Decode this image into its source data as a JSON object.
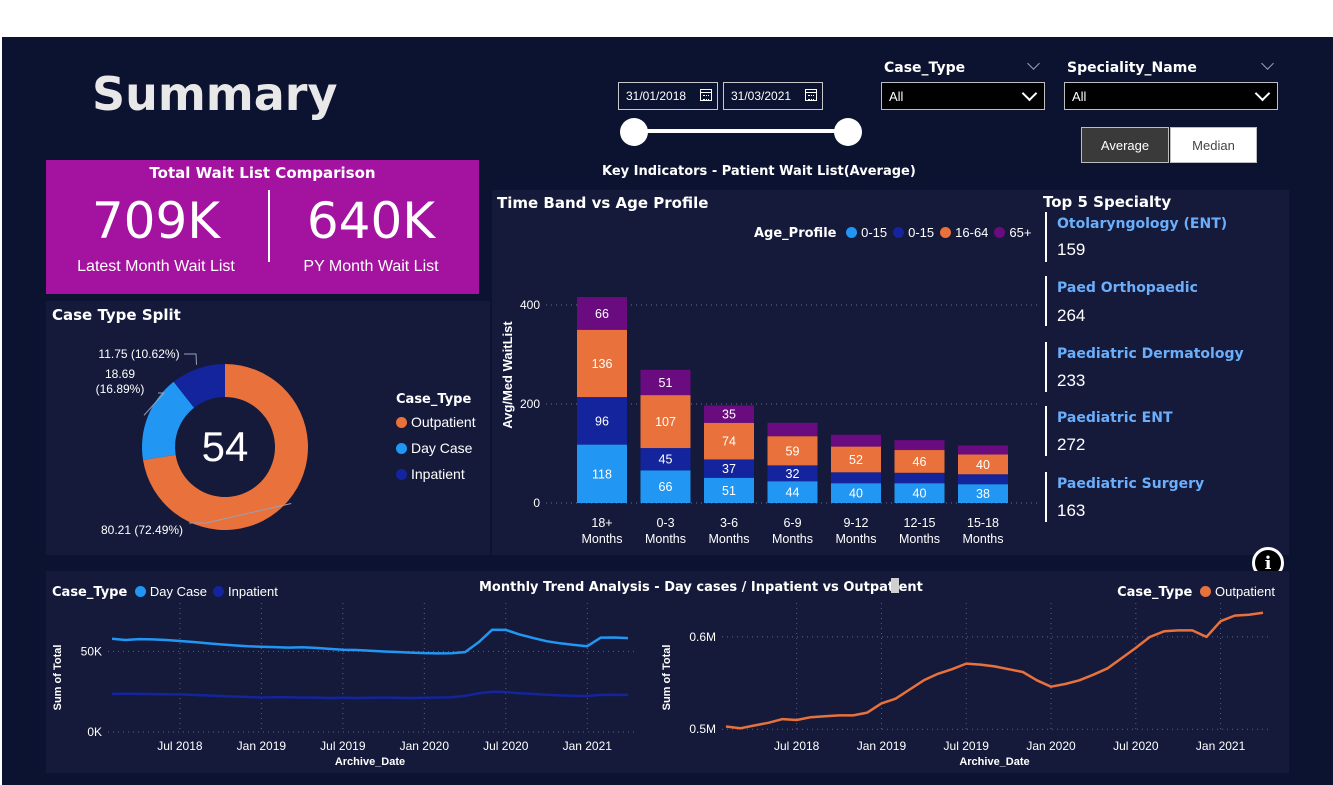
{
  "page": {
    "title": "Summary"
  },
  "filters": {
    "start_date": "31/01/2018",
    "end_date": "31/03/2021",
    "case_type": {
      "label": "Case_Type",
      "value": "All"
    },
    "speciality": {
      "label": "Speciality_Name",
      "value": "All"
    },
    "stat_toggle": {
      "average": "Average",
      "median": "Median",
      "selected": "Average"
    }
  },
  "key_indicators_title": "Key Indicators - Patient Wait List(Average)",
  "kpi": {
    "title": "Total Wait List Comparison",
    "latest_value": "709K",
    "latest_label": "Latest Month Wait List",
    "py_value": "640K",
    "py_label": "PY Month Wait List",
    "color": "#a3139f"
  },
  "top5": {
    "title": "Top 5 Specialty",
    "items": [
      {
        "name": "Otolaryngology (ENT)",
        "value": "159"
      },
      {
        "name": "Paed Orthopaedic",
        "value": "264"
      },
      {
        "name": "Paediatric Dermatology",
        "value": "233"
      },
      {
        "name": "Paediatric ENT",
        "value": "272"
      },
      {
        "name": "Paediatric Surgery",
        "value": "163"
      }
    ]
  },
  "chart_data": [
    {
      "id": "case-type-split",
      "type": "pie",
      "title": "Case Type Split",
      "center_value": "54",
      "legend_title": "Case_Type",
      "legend_position": "right",
      "slices": [
        {
          "name": "Outpatient",
          "value": 80.21,
          "label": "80.21 (72.49%)",
          "color": "#e8713c"
        },
        {
          "name": "Day Case",
          "value": 18.69,
          "label": "18.69 (16.89%)",
          "label_lines": [
            "18.69",
            "(16.89%)"
          ],
          "color": "#2196f3"
        },
        {
          "name": "Inpatient",
          "value": 11.75,
          "label": "11.75 (10.62%)",
          "color": "#13249c"
        }
      ]
    },
    {
      "id": "time-band-age",
      "type": "bar",
      "stacked": true,
      "title": "Time Band vs Age Profile",
      "ylabel": "Avg/Med WaitList",
      "xlabel": "",
      "ylim": [
        0,
        400
      ],
      "yticks": [
        0,
        200,
        400
      ],
      "grid": true,
      "legend_title": "Age_Profile",
      "legend_position": "top-right",
      "categories": [
        [
          "18+",
          "Months"
        ],
        [
          "0-3",
          "Months"
        ],
        [
          "3-6",
          "Months"
        ],
        [
          "6-9",
          "Months"
        ],
        [
          "9-12",
          "Months"
        ],
        [
          "12-15",
          "Months"
        ],
        [
          "15-18",
          "Months"
        ]
      ],
      "series": [
        {
          "name": "0-15",
          "color": "#2196f3",
          "values": [
            118,
            66,
            51,
            44,
            40,
            40,
            38
          ],
          "labels": [
            "118",
            "66",
            "51",
            "44",
            "40",
            "40",
            "38"
          ]
        },
        {
          "name": "0-15",
          "color": "#13249c",
          "values": [
            96,
            45,
            37,
            32,
            22,
            21,
            20
          ],
          "labels": [
            "96",
            "45",
            "37",
            "32",
            "",
            "",
            ""
          ]
        },
        {
          "name": "16-64",
          "color": "#e8713c",
          "values": [
            136,
            107,
            74,
            59,
            52,
            46,
            40
          ],
          "labels": [
            "136",
            "107",
            "74",
            "59",
            "52",
            "46",
            "40"
          ]
        },
        {
          "name": "65+",
          "color": "#6a0b80",
          "values": [
            66,
            51,
            35,
            27,
            24,
            20,
            18
          ],
          "labels": [
            "66",
            "51",
            "35",
            "",
            "",
            "",
            ""
          ]
        }
      ]
    },
    {
      "id": "trend-daycase-inpatient",
      "type": "line",
      "title": "Monthly Trend Analysis - Day cases / Inpatient vs Outpatient",
      "xlabel": "Archive_Date",
      "ylabel": "Sum of Total",
      "legend_title": "Case_Type",
      "legend_position": "top-left",
      "yticks": [
        {
          "value": 0,
          "label": "0K"
        },
        {
          "value": 50000,
          "label": "50K"
        }
      ],
      "ylim": [
        0,
        75000
      ],
      "xticks": [
        "Jul 2018",
        "Jan 2019",
        "Jul 2019",
        "Jan 2020",
        "Jul 2020",
        "Jan 2021"
      ],
      "x": [
        "Feb 2018",
        "Mar 2018",
        "Apr 2018",
        "May 2018",
        "Jun 2018",
        "Jul 2018",
        "Aug 2018",
        "Sep 2018",
        "Oct 2018",
        "Nov 2018",
        "Dec 2018",
        "Jan 2019",
        "Feb 2019",
        "Mar 2019",
        "Apr 2019",
        "May 2019",
        "Jun 2019",
        "Jul 2019",
        "Aug 2019",
        "Sep 2019",
        "Oct 2019",
        "Nov 2019",
        "Dec 2019",
        "Jan 2020",
        "Feb 2020",
        "Mar 2020",
        "Apr 2020",
        "May 2020",
        "Jun 2020",
        "Jul 2020",
        "Aug 2020",
        "Sep 2020",
        "Oct 2020",
        "Nov 2020",
        "Dec 2020",
        "Jan 2021",
        "Feb 2021",
        "Mar 2021",
        "Apr 2021"
      ],
      "series": [
        {
          "name": "Day Case",
          "color": "#2196f3",
          "values": [
            57800,
            57000,
            57600,
            57400,
            57000,
            56400,
            55800,
            55000,
            54300,
            53700,
            53100,
            52900,
            52600,
            52300,
            52500,
            52100,
            51500,
            51000,
            50800,
            50300,
            49900,
            49600,
            49200,
            48900,
            48700,
            48800,
            49500,
            55600,
            63400,
            63300,
            60500,
            58300,
            56300,
            55000,
            54000,
            53200,
            58500,
            58600,
            58200
          ],
          "labels": []
        },
        {
          "name": "Inpatient",
          "color": "#13249c",
          "values": [
            23600,
            23700,
            23600,
            23500,
            23400,
            23300,
            23000,
            22600,
            22300,
            22000,
            21700,
            21400,
            21600,
            21500,
            21300,
            21300,
            21100,
            21200,
            21100,
            21200,
            21300,
            21200,
            21100,
            21200,
            21400,
            21500,
            22400,
            24000,
            25000,
            24800,
            24000,
            23600,
            23100,
            22700,
            22400,
            22300,
            23000,
            23100,
            23000
          ],
          "labels": []
        }
      ]
    },
    {
      "id": "trend-outpatient",
      "type": "line",
      "title": "",
      "xlabel": "Archive_Date",
      "ylabel": "Sum of Total",
      "legend_title": "Case_Type",
      "legend_position": "top-right",
      "yticks": [
        {
          "value": 0.5,
          "label": "0.5M"
        },
        {
          "value": 0.6,
          "label": "0.6M"
        }
      ],
      "ylim": [
        0.497,
        0.628
      ],
      "xticks": [
        "Jul 2018",
        "Jan 2019",
        "Jul 2019",
        "Jan 2020",
        "Jul 2020",
        "Jan 2021"
      ],
      "x": [
        "Feb 2018",
        "Mar 2018",
        "Apr 2018",
        "May 2018",
        "Jun 2018",
        "Jul 2018",
        "Aug 2018",
        "Sep 2018",
        "Oct 2018",
        "Nov 2018",
        "Dec 2018",
        "Jan 2019",
        "Feb 2019",
        "Mar 2019",
        "Apr 2019",
        "May 2019",
        "Jun 2019",
        "Jul 2019",
        "Aug 2019",
        "Sep 2019",
        "Oct 2019",
        "Nov 2019",
        "Dec 2019",
        "Jan 2020",
        "Feb 2020",
        "Mar 2020",
        "Apr 2020",
        "May 2020",
        "Jun 2020",
        "Jul 2020",
        "Aug 2020",
        "Sep 2020",
        "Oct 2020",
        "Nov 2020",
        "Dec 2020",
        "Jan 2021",
        "Feb 2021",
        "Mar 2021",
        "Apr 2021"
      ],
      "series": [
        {
          "name": "Outpatient",
          "color": "#e8713c",
          "values": [
            0.503,
            0.501,
            0.504,
            0.507,
            0.511,
            0.51,
            0.513,
            0.514,
            0.515,
            0.515,
            0.518,
            0.528,
            0.533,
            0.543,
            0.553,
            0.56,
            0.565,
            0.571,
            0.57,
            0.568,
            0.565,
            0.562,
            0.553,
            0.546,
            0.549,
            0.553,
            0.559,
            0.566,
            0.577,
            0.588,
            0.6,
            0.606,
            0.607,
            0.607,
            0.6,
            0.617,
            0.623,
            0.624,
            0.626
          ],
          "labels": []
        }
      ]
    }
  ]
}
